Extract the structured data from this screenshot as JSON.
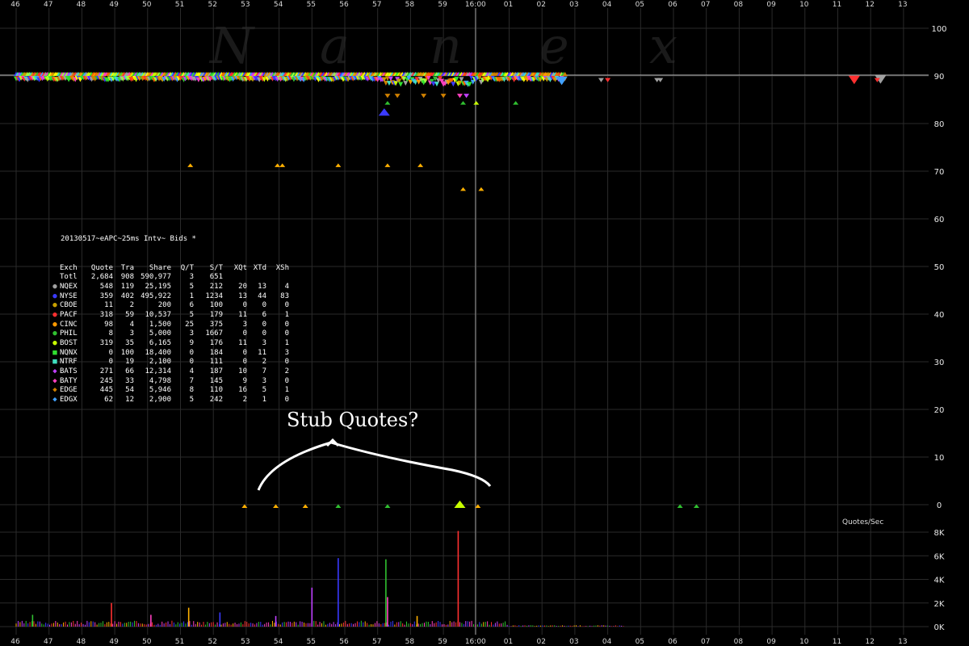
{
  "chart_data": {
    "type": "scatter",
    "watermark": [
      "N",
      "a",
      "n",
      "e",
      "x"
    ],
    "x_ticks": [
      "46",
      "47",
      "48",
      "49",
      "50",
      "51",
      "52",
      "53",
      "54",
      "55",
      "56",
      "57",
      "58",
      "59",
      "16:00",
      "01",
      "02",
      "03",
      "04",
      "05",
      "06",
      "07",
      "08",
      "09",
      "10",
      "11",
      "12",
      "13"
    ],
    "y_ticks_price": [
      "100",
      "90",
      "80",
      "70",
      "60",
      "50",
      "40",
      "30",
      "20",
      "10",
      "0"
    ],
    "y_ticks_volume": [
      "8K",
      "6K",
      "4K",
      "2K",
      "0K"
    ],
    "vertical_marker": "16:00",
    "reference_price": 90,
    "volume_label": "Quotes/Sec",
    "annotation": "Stub Quotes?",
    "legend": {
      "title": "20130517~eAPC~25ms Intv~ Bids *",
      "headers": [
        "Exch",
        "Quote",
        "Tra",
        "Share",
        "Q/T",
        "S/T",
        "XQt",
        "XTd",
        "XSh"
      ],
      "total": [
        "Totl",
        "2,684",
        "908",
        "590,977",
        "3",
        "651",
        "",
        "",
        ""
      ],
      "rows": [
        {
          "exch": "NQEX",
          "quote": "548",
          "tra": "119",
          "share": "25,195",
          "qt": "5",
          "st": "212",
          "xqt": "20",
          "xtd": "13",
          "xsh": "4",
          "color": "#a0a0a0",
          "shape": "circle"
        },
        {
          "exch": "NYSE",
          "quote": "359",
          "tra": "402",
          "share": "495,922",
          "qt": "1",
          "st": "1234",
          "xqt": "13",
          "xtd": "44",
          "xsh": "83",
          "color": "#3a3aff",
          "shape": "circle"
        },
        {
          "exch": "CBOE",
          "quote": "11",
          "tra": "2",
          "share": "200",
          "qt": "6",
          "st": "100",
          "xqt": "0",
          "xtd": "0",
          "xsh": "0",
          "color": "#c8a000",
          "shape": "circle"
        },
        {
          "exch": "PACF",
          "quote": "318",
          "tra": "59",
          "share": "10,537",
          "qt": "5",
          "st": "179",
          "xqt": "11",
          "xtd": "6",
          "xsh": "1",
          "color": "#ff3030",
          "shape": "circle"
        },
        {
          "exch": "CINC",
          "quote": "98",
          "tra": "4",
          "share": "1,500",
          "qt": "25",
          "st": "375",
          "xqt": "3",
          "xtd": "0",
          "xsh": "0",
          "color": "#ff9900",
          "shape": "circle"
        },
        {
          "exch": "PHIL",
          "quote": "8",
          "tra": "3",
          "share": "5,000",
          "qt": "3",
          "st": "1667",
          "xqt": "0",
          "xtd": "0",
          "xsh": "0",
          "color": "#30c030",
          "shape": "circle"
        },
        {
          "exch": "BOST",
          "quote": "319",
          "tra": "35",
          "share": "6,165",
          "qt": "9",
          "st": "176",
          "xqt": "11",
          "xtd": "3",
          "xsh": "1",
          "color": "#c8ff00",
          "shape": "circle"
        },
        {
          "exch": "NQNX",
          "quote": "0",
          "tra": "100",
          "share": "18,400",
          "qt": "0",
          "st": "184",
          "xqt": "0",
          "xtd": "11",
          "xsh": "3",
          "color": "#30e030",
          "shape": "square"
        },
        {
          "exch": "NTRF",
          "quote": "0",
          "tra": "19",
          "share": "2,100",
          "qt": "0",
          "st": "111",
          "xqt": "0",
          "xtd": "2",
          "xsh": "0",
          "color": "#40e0c0",
          "shape": "square"
        },
        {
          "exch": "BATS",
          "quote": "271",
          "tra": "66",
          "share": "12,314",
          "qt": "4",
          "st": "187",
          "xqt": "10",
          "xtd": "7",
          "xsh": "2",
          "color": "#c040ff",
          "shape": "diamond"
        },
        {
          "exch": "BATY",
          "quote": "245",
          "tra": "33",
          "share": "4,798",
          "qt": "7",
          "st": "145",
          "xqt": "9",
          "xtd": "3",
          "xsh": "0",
          "color": "#ff40c0",
          "shape": "diamond"
        },
        {
          "exch": "EDGE",
          "quote": "445",
          "tra": "54",
          "share": "5,946",
          "qt": "8",
          "st": "110",
          "xqt": "16",
          "xtd": "5",
          "xsh": "1",
          "color": "#d08000",
          "shape": "diamond"
        },
        {
          "exch": "EDGX",
          "quote": "62",
          "tra": "12",
          "share": "2,900",
          "qt": "5",
          "st": "242",
          "xqt": "2",
          "xtd": "1",
          "xsh": "0",
          "color": "#40a0ff",
          "shape": "diamond"
        }
      ]
    },
    "bid_points": [
      {
        "x": 51.3,
        "y": 71.2,
        "c": "#ffb000"
      },
      {
        "x": 53.95,
        "y": 71.2,
        "c": "#ffb000"
      },
      {
        "x": 54.1,
        "y": 71.2,
        "c": "#ffb000"
      },
      {
        "x": 55.8,
        "y": 71.2,
        "c": "#ffb000"
      },
      {
        "x": 57.3,
        "y": 71.2,
        "c": "#ffb000"
      },
      {
        "x": 58.3,
        "y": 71.2,
        "c": "#ffb000"
      },
      {
        "x": 59.6,
        "y": 66.2,
        "c": "#ffb000"
      },
      {
        "x": 60.15,
        "y": 66.2,
        "c": "#ffb000"
      },
      {
        "x": 57.2,
        "y": 82,
        "c": "#3a3aff",
        "big": true
      },
      {
        "x": 57.3,
        "y": 86,
        "c": "#d08000"
      },
      {
        "x": 57.6,
        "y": 86,
        "c": "#d08000"
      },
      {
        "x": 58.4,
        "y": 86,
        "c": "#d08000"
      },
      {
        "x": 59.0,
        "y": 86,
        "c": "#d08000"
      },
      {
        "x": 59.5,
        "y": 86,
        "c": "#ff40c0"
      },
      {
        "x": 59.7,
        "y": 86,
        "c": "#c040ff"
      },
      {
        "x": 57.3,
        "y": 84.3,
        "c": "#30c030"
      },
      {
        "x": 59.6,
        "y": 84.3,
        "c": "#30c030"
      },
      {
        "x": 60.0,
        "y": 84.3,
        "c": "#c8ff00"
      },
      {
        "x": 61.2,
        "y": 84.3,
        "c": "#30c030"
      },
      {
        "x": 62.6,
        "y": 89,
        "c": "#40a0ff",
        "big": true
      },
      {
        "x": 63.8,
        "y": 89.3,
        "c": "#a0a0a0"
      },
      {
        "x": 64.0,
        "y": 89.3,
        "c": "#ff3030"
      },
      {
        "x": 65.5,
        "y": 89.3,
        "c": "#a0a0a0"
      },
      {
        "x": 65.6,
        "y": 89.3,
        "c": "#a0a0a0"
      },
      {
        "x": 71.5,
        "y": 89.2,
        "c": "#ff3030",
        "big": true
      },
      {
        "x": 72.3,
        "y": 89.3,
        "c": "#a0a0a0",
        "big": true
      },
      {
        "x": 72.2,
        "y": 89.3,
        "c": "#ff3030"
      },
      {
        "x": 52.95,
        "y": 0,
        "c": "#ffb000"
      },
      {
        "x": 53.9,
        "y": 0,
        "c": "#ffb000"
      },
      {
        "x": 54.8,
        "y": 0,
        "c": "#ffb000"
      },
      {
        "x": 55.8,
        "y": 0,
        "c": "#30c030"
      },
      {
        "x": 57.3,
        "y": 0,
        "c": "#30c030"
      },
      {
        "x": 59.5,
        "y": 0,
        "c": "#c8ff00",
        "big": true
      },
      {
        "x": 60.05,
        "y": 0,
        "c": "#ffb000"
      },
      {
        "x": 66.2,
        "y": 0,
        "c": "#30c030"
      },
      {
        "x": 66.7,
        "y": 0,
        "c": "#30c030"
      }
    ],
    "volume_spikes": [
      {
        "x": 48.9,
        "v": 2000
      },
      {
        "x": 51.25,
        "v": 1600
      },
      {
        "x": 55.0,
        "v": 3300
      },
      {
        "x": 55.8,
        "v": 5800
      },
      {
        "x": 57.25,
        "v": 5700
      },
      {
        "x": 57.3,
        "v": 2500
      },
      {
        "x": 59.45,
        "v": 8100
      },
      {
        "x": 58.2,
        "v": 900
      },
      {
        "x": 53.9,
        "v": 900
      },
      {
        "x": 52.2,
        "v": 1200
      },
      {
        "x": 46.5,
        "v": 1000
      },
      {
        "x": 50.1,
        "v": 1000
      }
    ]
  }
}
